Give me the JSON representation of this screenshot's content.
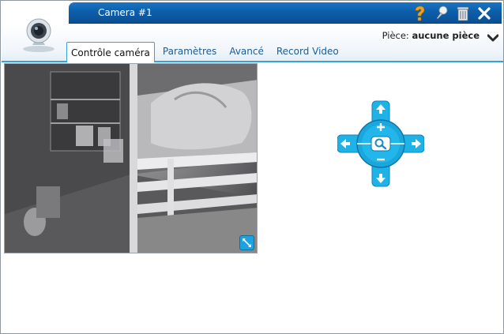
{
  "window": {
    "title": "Camera #1"
  },
  "room": {
    "label": "Pièce:",
    "value": "aucune pièce"
  },
  "tabs": [
    {
      "label": "Contrôle caméra",
      "active": true
    },
    {
      "label": "Paramètres",
      "active": false
    },
    {
      "label": "Avancé",
      "active": false
    },
    {
      "label": "Record Video",
      "active": false
    }
  ],
  "icons": {
    "help": "question-mark-icon",
    "pin": "pin-icon",
    "trash": "trash-icon",
    "close": "close-icon",
    "logo": "webcam-icon",
    "dropdown": "chevron-down-icon",
    "fullscreen": "expand-icon",
    "zoom": "magnifier-icon"
  },
  "colors": {
    "titlebar": "#0d5ea9",
    "accent": "#1aa3e0",
    "help_icon": "#f2a21a"
  }
}
